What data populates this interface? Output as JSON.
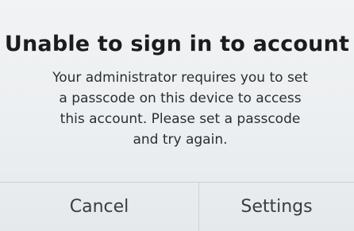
{
  "alert": {
    "title": "Unable to sign in to account",
    "message_lines": [
      "Your administrator requires you to set",
      "a passcode on this device to access",
      "this account. Please set a passcode",
      "and try again."
    ],
    "buttons": {
      "cancel_label": "Cancel",
      "settings_label": "Settings"
    }
  }
}
